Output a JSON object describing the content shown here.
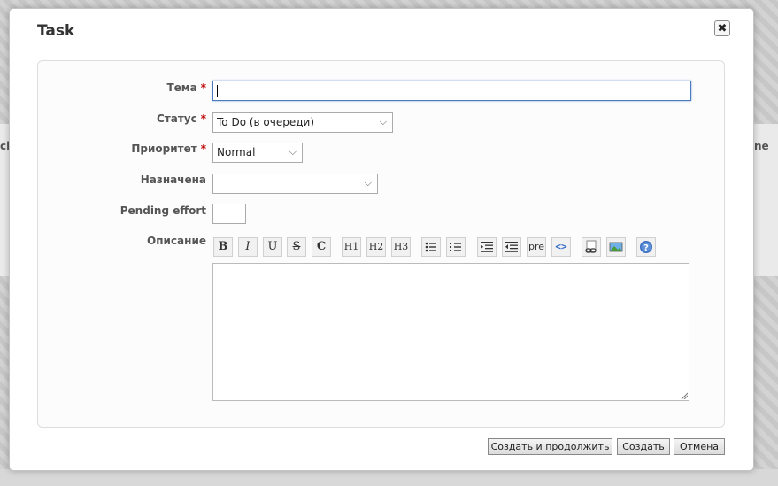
{
  "dialog": {
    "title": "Task",
    "close_icon": "✖"
  },
  "form": {
    "subject": {
      "label": "Тема",
      "value": ""
    },
    "status": {
      "label": "Статус",
      "value": "To Do (в очереди)"
    },
    "priority": {
      "label": "Приоритет",
      "value": "Normal"
    },
    "assignee": {
      "label": "Назначена",
      "value": ""
    },
    "pending_effort": {
      "label": "Pending effort",
      "value": ""
    },
    "description": {
      "label": "Описание",
      "value": ""
    },
    "required_mark": "*"
  },
  "toolbar": {
    "bold": "B",
    "italic": "I",
    "underline": "U",
    "strike": "S",
    "code": "C",
    "h1": "H1",
    "h2": "H2",
    "h3": "H3",
    "pre": "pre",
    "icons": [
      "bold-icon",
      "italic-icon",
      "underline-icon",
      "strikethrough-icon",
      "code-icon",
      "h1-icon",
      "h2-icon",
      "h3-icon",
      "unordered-list-icon",
      "ordered-list-icon",
      "indent-icon",
      "outdent-icon",
      "pre-icon",
      "code-tag-icon",
      "link-icon",
      "image-icon",
      "help-icon"
    ]
  },
  "buttons": {
    "create_continue": "Создать и продолжить",
    "create": "Создать",
    "cancel": "Отмена"
  },
  "background": {
    "left_fragment": "ck",
    "right_fragment": "ne"
  },
  "colors": {
    "required": "#bb0000",
    "focus_border": "#4a7bbf",
    "help": "#3b6fbf"
  }
}
